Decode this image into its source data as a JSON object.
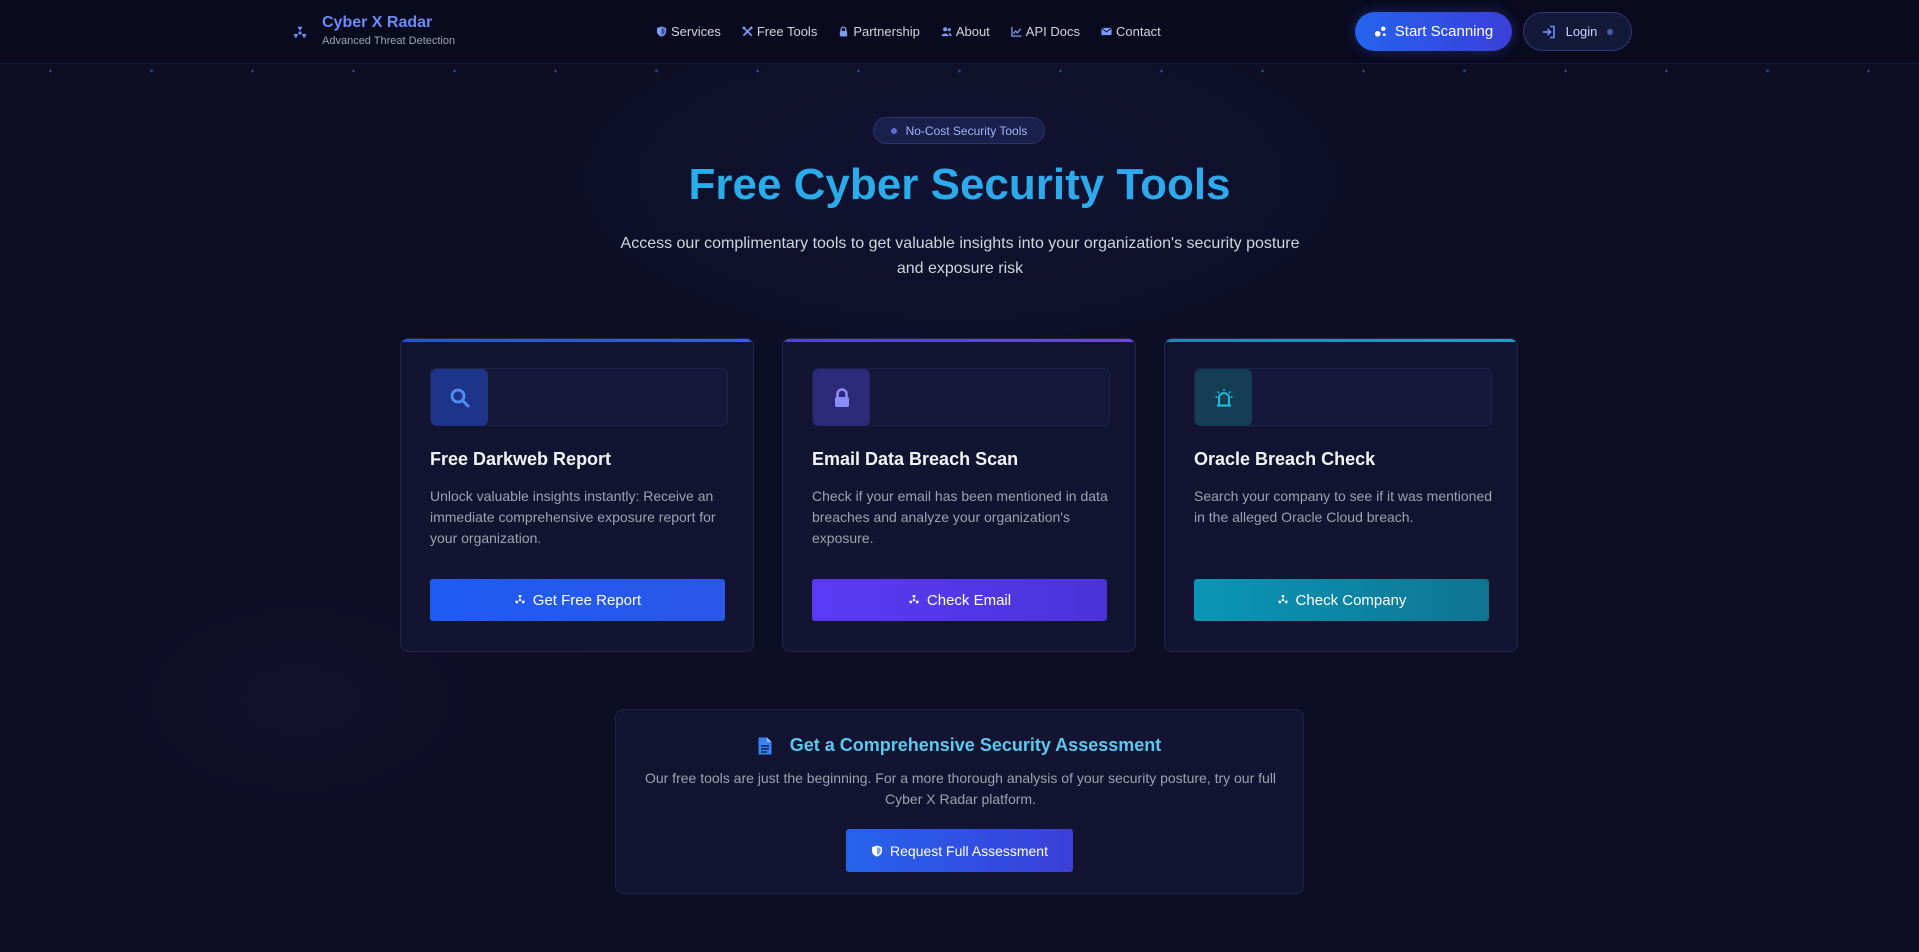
{
  "brand": {
    "title": "Cyber X Radar",
    "subtitle": "Advanced Threat Detection",
    "icon": "radiation-icon"
  },
  "nav": {
    "items": [
      {
        "label": "Services",
        "icon": "shield-icon"
      },
      {
        "label": "Free Tools",
        "icon": "tools-icon"
      },
      {
        "label": "Partnership",
        "icon": "lock-icon"
      },
      {
        "label": "About",
        "icon": "users-icon"
      },
      {
        "label": "API Docs",
        "icon": "chart-line-icon"
      },
      {
        "label": "Contact",
        "icon": "envelope-icon"
      }
    ],
    "start_scanning": "Start Scanning",
    "login": "Login"
  },
  "hero": {
    "badge": "No-Cost Security Tools",
    "title": "Free Cyber Security Tools",
    "subtitle": "Access our complimentary tools to get valuable insights into your organization's security posture and exposure risk"
  },
  "cards": [
    {
      "title": "Free Darkweb Report",
      "description": "Unlock valuable insights instantly: Receive an immediate comprehensive exposure report for your organization.",
      "button": "Get Free Report",
      "icon": "search-icon",
      "accent": "#2563eb"
    },
    {
      "title": "Email Data Breach Scan",
      "description": "Check if your email has been mentioned in data breaches and analyze your organization's exposure.",
      "button": "Check Email",
      "icon": "lock-icon",
      "accent": "#5b3ff0"
    },
    {
      "title": "Oracle Breach Check",
      "description": "Search your company to see if it was mentioned in the alleged Oracle Cloud breach.",
      "button": "Check Company",
      "icon": "alarm-icon",
      "accent": "#0891b2"
    }
  ],
  "assessment": {
    "title": "Get a Comprehensive Security Assessment",
    "description": "Our free tools are just the beginning. For a more thorough analysis of your security posture, try our full Cyber X Radar platform.",
    "button": "Request Full Assessment",
    "icon": "document-icon"
  },
  "colors": {
    "background": "#0d0d24",
    "brand_accent": "#6a8cf5",
    "title_gradient_start": "#1fb5e5",
    "primary_button": "#2563eb"
  }
}
